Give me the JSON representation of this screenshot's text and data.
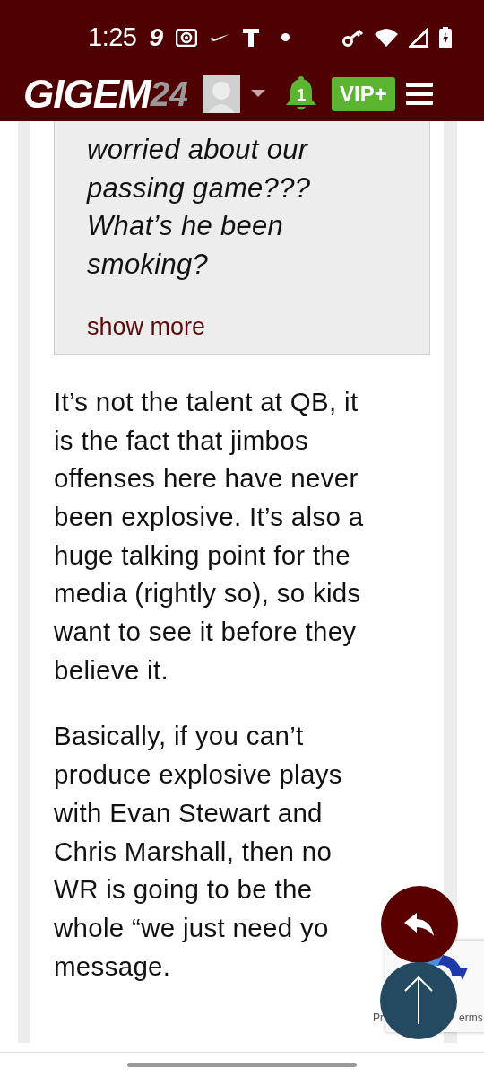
{
  "status_bar": {
    "time": "1:25",
    "badge_text": "9",
    "notification_dot": true
  },
  "header": {
    "logo_main": "GIGEM",
    "logo_suffix": "24",
    "notifications": "1",
    "vip_label": "VIP+"
  },
  "quote": {
    "lines": [
      "worried about our",
      "passing game???",
      "What’s he been",
      "smoking?"
    ],
    "show_more": "show more"
  },
  "paragraphs": [
    {
      "lines": [
        "It’s not the talent at QB, it",
        "is the fact that jimbos",
        "offenses here have never",
        "been explosive. It’s also a",
        "huge talking point for the",
        "media (rightly so), so kids",
        "want to see it before they",
        "believe it."
      ]
    },
    {
      "lines": [
        "Basically, if you can’t",
        "produce explosive plays",
        "with Evan Stewart and",
        "Chris Marshall, then no",
        "WR is going to be the",
        "whole “we just need yo",
        "message."
      ]
    }
  ],
  "recaptcha": {
    "left_text": "Pr",
    "right_text": "erms"
  }
}
